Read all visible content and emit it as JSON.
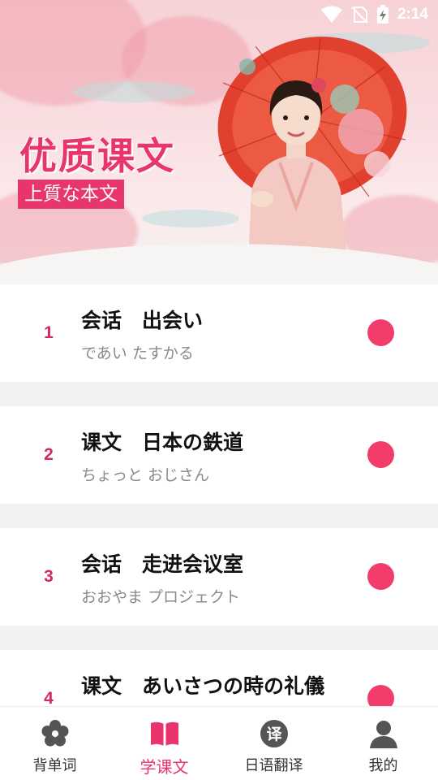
{
  "status_bar": {
    "time": "2:14"
  },
  "banner": {
    "title": "优质课文",
    "subtitle": "上質な本文"
  },
  "lessons": [
    {
      "number": "1",
      "title": "会话　出会い",
      "subtitle": "であい たすかる"
    },
    {
      "number": "2",
      "title": "课文　日本の鉄道",
      "subtitle": "ちょっと おじさん"
    },
    {
      "number": "3",
      "title": "会话　走进会议室",
      "subtitle": "おおやま プロジェクト"
    },
    {
      "number": "4",
      "title": "课文　あいさつの時の礼儀",
      "subtitle": ""
    }
  ],
  "nav": [
    {
      "label": "背单词",
      "icon": "flower-icon",
      "active": false
    },
    {
      "label": "学课文",
      "icon": "book-icon",
      "active": true
    },
    {
      "label": "日语翻译",
      "icon": "translate-icon",
      "active": false
    },
    {
      "label": "我的",
      "icon": "user-icon",
      "active": false
    }
  ],
  "colors": {
    "accent": "#e8356b",
    "dot": "#f23d6b",
    "number": "#d12a5a",
    "nav_inactive": "#555555"
  }
}
